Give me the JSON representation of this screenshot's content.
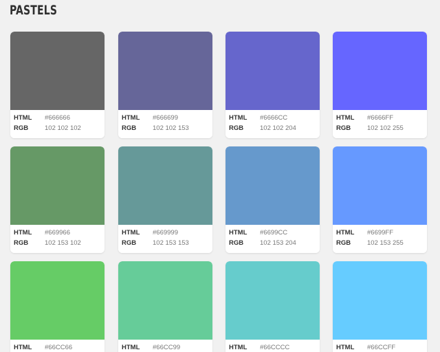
{
  "page": {
    "title": "PASTELS"
  },
  "labels": {
    "html": "HTML",
    "rgb": "RGB"
  },
  "colors": [
    {
      "hex": "#666666",
      "rgb": "102 102 102"
    },
    {
      "hex": "#666699",
      "rgb": "102 102 153"
    },
    {
      "hex": "#6666CC",
      "rgb": "102 102 204"
    },
    {
      "hex": "#6666FF",
      "rgb": "102 102 255"
    },
    {
      "hex": "#669966",
      "rgb": "102 153 102"
    },
    {
      "hex": "#669999",
      "rgb": "102 153 153"
    },
    {
      "hex": "#6699CC",
      "rgb": "102 153 204"
    },
    {
      "hex": "#6699FF",
      "rgb": "102 153 255"
    },
    {
      "hex": "#66CC66",
      "rgb": ""
    },
    {
      "hex": "#66CC99",
      "rgb": ""
    },
    {
      "hex": "#66CCCC",
      "rgb": ""
    },
    {
      "hex": "#66CCFF",
      "rgb": ""
    }
  ]
}
